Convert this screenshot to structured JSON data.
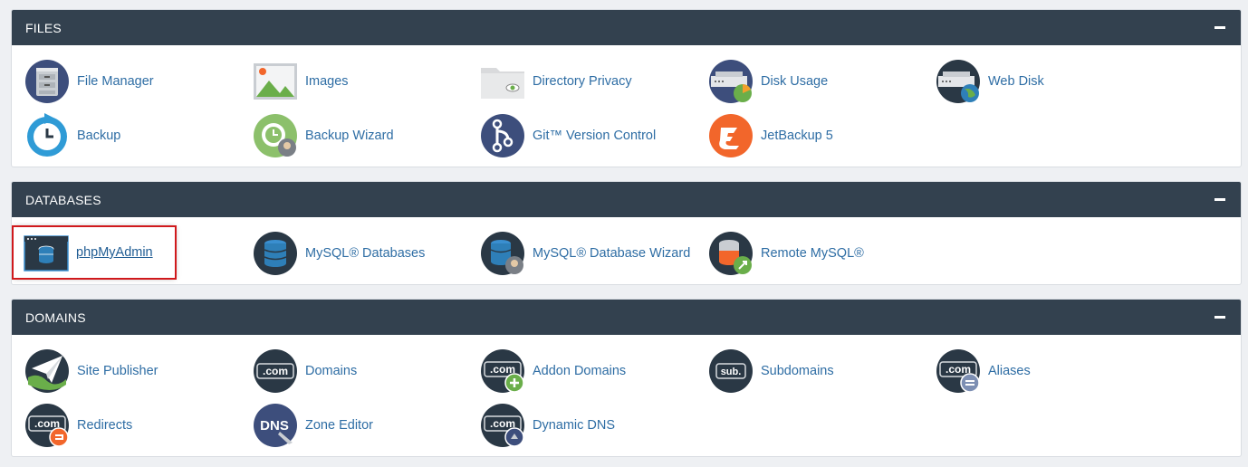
{
  "files": {
    "title": "FILES",
    "items": [
      {
        "label": "File Manager",
        "icon": "file-cabinet-icon"
      },
      {
        "label": "Images",
        "icon": "image-icon"
      },
      {
        "label": "Directory Privacy",
        "icon": "folder-eye-icon"
      },
      {
        "label": "Disk Usage",
        "icon": "disk-usage-icon"
      },
      {
        "label": "Web Disk",
        "icon": "web-disk-icon"
      },
      {
        "label": "Backup",
        "icon": "backup-icon"
      },
      {
        "label": "Backup Wizard",
        "icon": "backup-wizard-icon"
      },
      {
        "label": "Git™ Version Control",
        "icon": "git-icon"
      },
      {
        "label": "JetBackup 5",
        "icon": "jetbackup-icon"
      }
    ]
  },
  "databases": {
    "title": "DATABASES",
    "items": [
      {
        "label": "phpMyAdmin",
        "icon": "phpmyadmin-icon"
      },
      {
        "label": "MySQL® Databases",
        "icon": "database-icon"
      },
      {
        "label": "MySQL® Database Wizard",
        "icon": "database-wizard-icon"
      },
      {
        "label": "Remote MySQL®",
        "icon": "remote-database-icon"
      }
    ]
  },
  "domains": {
    "title": "DOMAINS",
    "items": [
      {
        "label": "Site Publisher",
        "icon": "paper-plane-icon"
      },
      {
        "label": "Domains",
        "icon": "dotcom-icon",
        "badge": ".com"
      },
      {
        "label": "Addon Domains",
        "icon": "addon-domain-icon",
        "badge": ".com"
      },
      {
        "label": "Subdomains",
        "icon": "subdomain-icon",
        "badge": "sub."
      },
      {
        "label": "Aliases",
        "icon": "alias-icon",
        "badge": ".com"
      },
      {
        "label": "Redirects",
        "icon": "redirect-icon",
        "badge": ".com"
      },
      {
        "label": "Zone Editor",
        "icon": "dns-zone-icon",
        "badge": "DNS"
      },
      {
        "label": "Dynamic DNS",
        "icon": "dynamic-dns-icon",
        "badge": ".com"
      }
    ]
  },
  "colors": {
    "header_bg": "#33414f",
    "link": "#2e6da4",
    "highlight_border": "#d0191c",
    "icon_dark": "#2a3845",
    "accent_green": "#6aae4a",
    "accent_orange": "#f2662b"
  }
}
